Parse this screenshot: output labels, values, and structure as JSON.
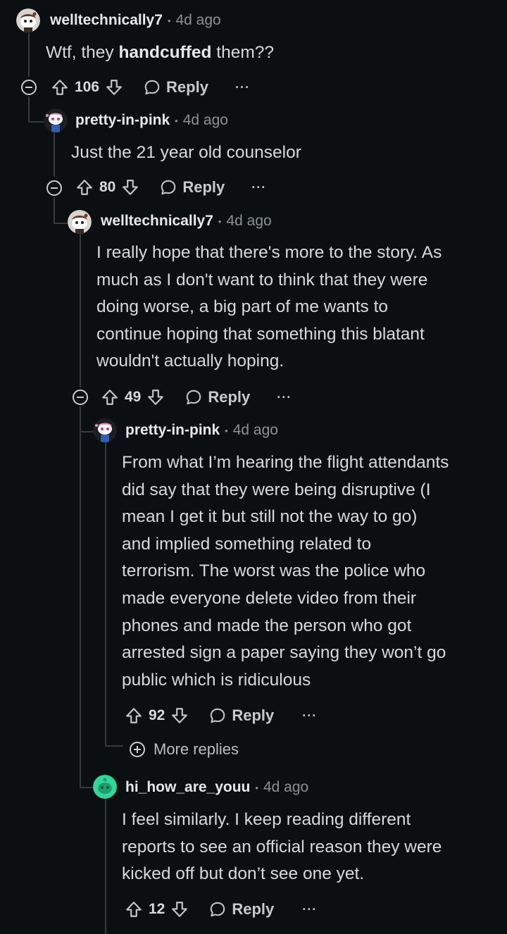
{
  "colors": {
    "background": "#0b0f12",
    "thread_line": "#343a3e",
    "avatar_green": "#2fd89a"
  },
  "comments": [
    {
      "username": "welltechnically7",
      "separator": "•",
      "time": "4d ago",
      "body_pre": "Wtf, they ",
      "body_bold": "handcuffed",
      "body_post": " them??",
      "score": "106",
      "reply_label": "Reply",
      "more_label": "···",
      "avatar_icon": "snoo-avatar-brown-icon"
    },
    {
      "username": "pretty-in-pink",
      "separator": "•",
      "time": "4d ago",
      "lines": [
        "Just the 21 year old counselor"
      ],
      "score": "80",
      "reply_label": "Reply",
      "more_label": "···",
      "avatar_icon": "snoo-avatar-pink-icon"
    },
    {
      "username": "welltechnically7",
      "separator": "•",
      "time": "4d ago",
      "lines": [
        "I really hope that there's more to the story. As",
        "much as I don't want to think that they were",
        "doing worse, a big part of me wants to",
        "continue hoping that something this blatant",
        "wouldn't actually hoping."
      ],
      "score": "49",
      "reply_label": "Reply",
      "more_label": "···",
      "avatar_icon": "snoo-avatar-brown-icon"
    },
    {
      "username": "pretty-in-pink",
      "separator": "•",
      "time": "4d ago",
      "lines": [
        "From what I’m hearing the flight attendants",
        "did say that they were being disruptive (I",
        "mean I get it but still not the way to go)",
        "and implied something related to",
        "terrorism. The worst was the police who",
        "made everyone delete video from their",
        "phones and made the person who got",
        "arrested sign a paper saying they won’t go",
        "public which is ridiculous"
      ],
      "score": "92",
      "reply_label": "Reply",
      "more_label": "···",
      "avatar_icon": "snoo-avatar-pink-icon"
    },
    {
      "username": "hi_how_are_youu",
      "separator": "•",
      "time": "4d ago",
      "lines": [
        "I feel similarly. I keep reading different",
        "reports to see an official reason they were",
        "kicked off but don’t see one yet."
      ],
      "score": "12",
      "reply_label": "Reply",
      "more_label": "···",
      "avatar_icon": "snoo-avatar-green-icon"
    }
  ],
  "more_replies_label": "More replies"
}
